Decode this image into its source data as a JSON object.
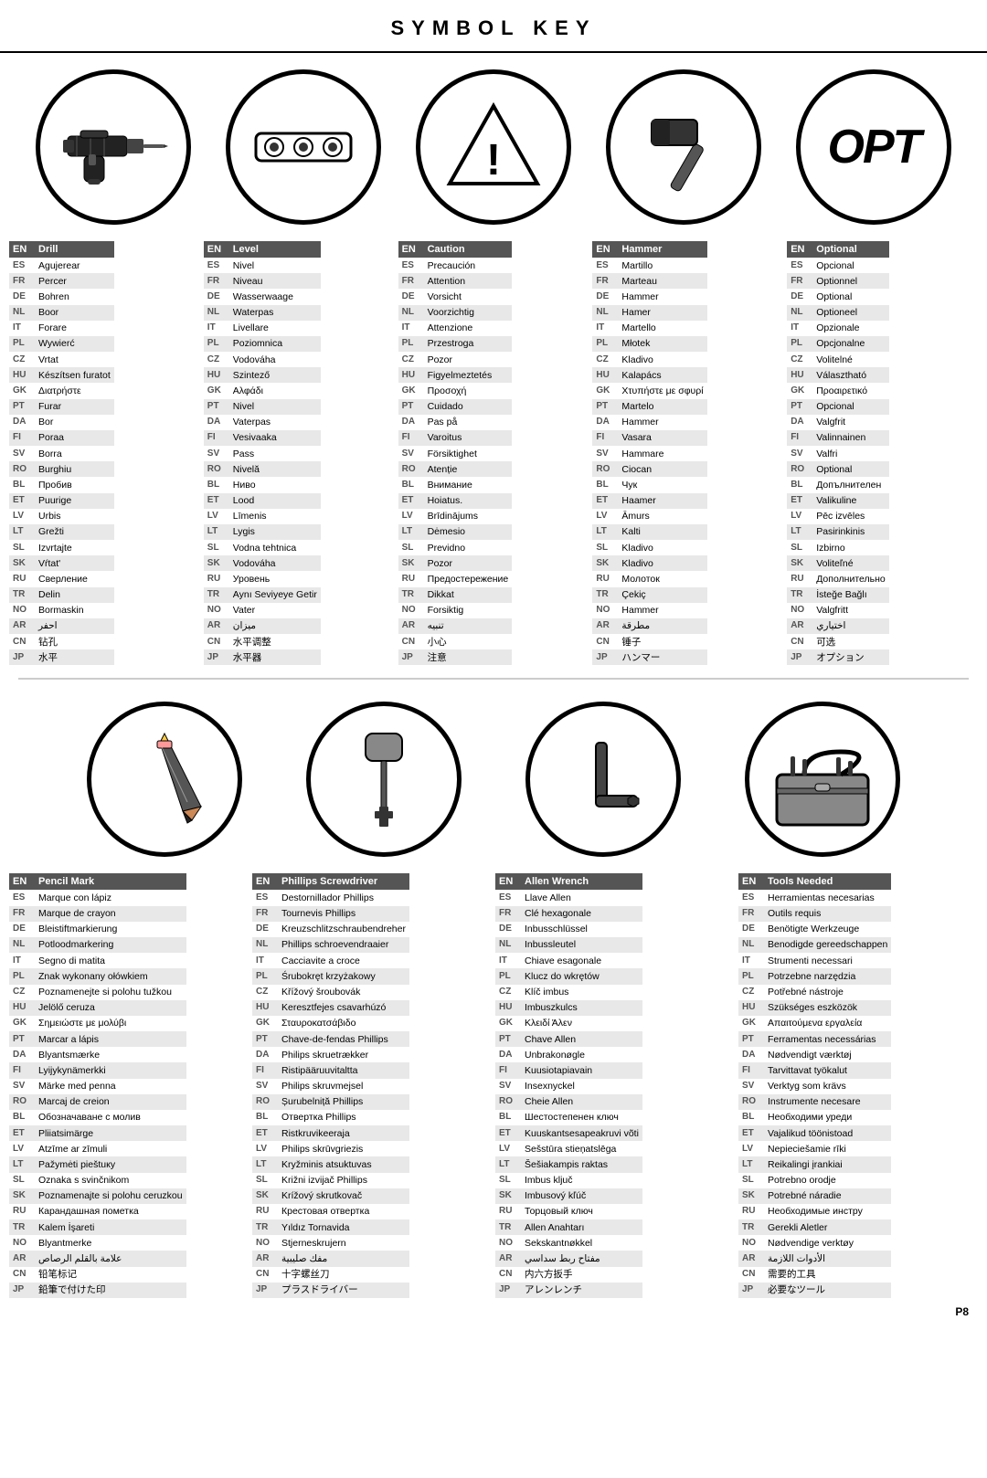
{
  "title": "SYMBOL KEY",
  "page_number": "P8",
  "icons_row1": [
    {
      "name": "drill",
      "type": "drill"
    },
    {
      "name": "level",
      "type": "level"
    },
    {
      "name": "caution",
      "type": "caution"
    },
    {
      "name": "hammer",
      "type": "hammer"
    },
    {
      "name": "optional",
      "type": "opt"
    }
  ],
  "icons_row2": [
    {
      "name": "pencil",
      "type": "pencil"
    },
    {
      "name": "phillips",
      "type": "phillips"
    },
    {
      "name": "allen",
      "type": "allen"
    },
    {
      "name": "toolbox",
      "type": "toolbox"
    }
  ],
  "tables": [
    {
      "id": "drill",
      "header_lang": "EN",
      "header_name": "Drill",
      "rows": [
        [
          "ES",
          "Agujerear"
        ],
        [
          "FR",
          "Percer"
        ],
        [
          "DE",
          "Bohren"
        ],
        [
          "NL",
          "Boor"
        ],
        [
          "IT",
          "Forare"
        ],
        [
          "PL",
          "Wywierć"
        ],
        [
          "CZ",
          "Vrtat"
        ],
        [
          "HU",
          "Készítsen furatot"
        ],
        [
          "GK",
          "Διατρήστε"
        ],
        [
          "PT",
          "Furar"
        ],
        [
          "DA",
          "Bor"
        ],
        [
          "FI",
          "Poraa"
        ],
        [
          "SV",
          "Borra"
        ],
        [
          "RO",
          "Burghiu"
        ],
        [
          "BL",
          "Пробив"
        ],
        [
          "ET",
          "Puurige"
        ],
        [
          "LV",
          "Urbis"
        ],
        [
          "LT",
          "Grežti"
        ],
        [
          "SL",
          "Izvrtajte"
        ],
        [
          "SK",
          "Vŕtat'"
        ],
        [
          "RU",
          "Сверление"
        ],
        [
          "TR",
          "Delin"
        ],
        [
          "NO",
          "Bormaskin"
        ],
        [
          "AR",
          "احفر"
        ],
        [
          "CN",
          "钻孔"
        ],
        [
          "JP",
          "水平"
        ]
      ]
    },
    {
      "id": "level",
      "header_lang": "EN",
      "header_name": "Level",
      "rows": [
        [
          "ES",
          "Nivel"
        ],
        [
          "FR",
          "Niveau"
        ],
        [
          "DE",
          "Wasserwaage"
        ],
        [
          "NL",
          "Waterpas"
        ],
        [
          "IT",
          "Livellare"
        ],
        [
          "PL",
          "Poziomnica"
        ],
        [
          "CZ",
          "Vodováha"
        ],
        [
          "HU",
          "Szintező"
        ],
        [
          "GK",
          "Αλφάδι"
        ],
        [
          "PT",
          "Nivel"
        ],
        [
          "DA",
          "Vaterpas"
        ],
        [
          "FI",
          "Vesivaaka"
        ],
        [
          "SV",
          "Pass"
        ],
        [
          "RO",
          "Nivelă"
        ],
        [
          "BL",
          "Ниво"
        ],
        [
          "ET",
          "Lood"
        ],
        [
          "LV",
          "Līmenis"
        ],
        [
          "LT",
          "Lygis"
        ],
        [
          "SL",
          "Vodna tehtnica"
        ],
        [
          "SK",
          "Vodováha"
        ],
        [
          "RU",
          "Уровень"
        ],
        [
          "TR",
          "Aynı Seviyeye Getir"
        ],
        [
          "NO",
          "Vater"
        ],
        [
          "AR",
          "ميزان"
        ],
        [
          "CN",
          "水平调整"
        ],
        [
          "JP",
          "水平器"
        ]
      ]
    },
    {
      "id": "caution",
      "header_lang": "EN",
      "header_name": "Caution",
      "rows": [
        [
          "ES",
          "Precaución"
        ],
        [
          "FR",
          "Attention"
        ],
        [
          "DE",
          "Vorsicht"
        ],
        [
          "NL",
          "Voorzichtig"
        ],
        [
          "IT",
          "Attenzione"
        ],
        [
          "PL",
          "Przestroga"
        ],
        [
          "CZ",
          "Pozor"
        ],
        [
          "HU",
          "Figyelmeztetés"
        ],
        [
          "GK",
          "Προσοχή"
        ],
        [
          "PT",
          "Cuidado"
        ],
        [
          "DA",
          "Pas på"
        ],
        [
          "FI",
          "Varoitus"
        ],
        [
          "SV",
          "Försiktighet"
        ],
        [
          "RO",
          "Atenție"
        ],
        [
          "BL",
          "Внимание"
        ],
        [
          "ET",
          "Hoiatus."
        ],
        [
          "LV",
          "Brīdinājums"
        ],
        [
          "LT",
          "Dėmesio"
        ],
        [
          "SL",
          "Previdno"
        ],
        [
          "SK",
          "Pozor"
        ],
        [
          "RU",
          "Предостережение"
        ],
        [
          "TR",
          "Dikkat"
        ],
        [
          "NO",
          "Forsiktig"
        ],
        [
          "AR",
          "تنبيه"
        ],
        [
          "CN",
          "小心"
        ],
        [
          "JP",
          "注意"
        ]
      ]
    },
    {
      "id": "hammer",
      "header_lang": "EN",
      "header_name": "Hammer",
      "rows": [
        [
          "ES",
          "Martillo"
        ],
        [
          "FR",
          "Marteau"
        ],
        [
          "DE",
          "Hammer"
        ],
        [
          "NL",
          "Hamer"
        ],
        [
          "IT",
          "Martello"
        ],
        [
          "PL",
          "Młotek"
        ],
        [
          "CZ",
          "Kladivo"
        ],
        [
          "HU",
          "Kalapács"
        ],
        [
          "GK",
          "Χτυπήστε με σφυρί"
        ],
        [
          "PT",
          "Martelo"
        ],
        [
          "DA",
          "Hammer"
        ],
        [
          "FI",
          "Vasara"
        ],
        [
          "SV",
          "Hammare"
        ],
        [
          "RO",
          "Ciocan"
        ],
        [
          "BL",
          "Чук"
        ],
        [
          "ET",
          "Haamer"
        ],
        [
          "LV",
          "Āmurs"
        ],
        [
          "LT",
          "Kalti"
        ],
        [
          "SL",
          "Kladivo"
        ],
        [
          "SK",
          "Kladivo"
        ],
        [
          "RU",
          "Молоток"
        ],
        [
          "TR",
          "Çekiç"
        ],
        [
          "NO",
          "Hammer"
        ],
        [
          "AR",
          "مطرقة"
        ],
        [
          "CN",
          "锤子"
        ],
        [
          "JP",
          "ハンマー"
        ]
      ]
    },
    {
      "id": "optional",
      "header_lang": "EN",
      "header_name": "Optional",
      "rows": [
        [
          "ES",
          "Opcional"
        ],
        [
          "FR",
          "Optionnel"
        ],
        [
          "DE",
          "Optional"
        ],
        [
          "NL",
          "Optioneel"
        ],
        [
          "IT",
          "Opzionale"
        ],
        [
          "PL",
          "Opcjonalne"
        ],
        [
          "CZ",
          "Volitelné"
        ],
        [
          "HU",
          "Választható"
        ],
        [
          "GK",
          "Προαιρετικό"
        ],
        [
          "PT",
          "Opcional"
        ],
        [
          "DA",
          "Valgfrit"
        ],
        [
          "FI",
          "Valinnainen"
        ],
        [
          "SV",
          "Valfri"
        ],
        [
          "RO",
          "Optional"
        ],
        [
          "BL",
          "Допълнителен"
        ],
        [
          "ET",
          "Valikuline"
        ],
        [
          "LV",
          "Pēc izvēles"
        ],
        [
          "LT",
          "Pasirinkinis"
        ],
        [
          "SL",
          "Izbirno"
        ],
        [
          "SK",
          "Voliteľné"
        ],
        [
          "RU",
          "Дополнительно"
        ],
        [
          "TR",
          "İsteğe Bağlı"
        ],
        [
          "NO",
          "Valgfritt"
        ],
        [
          "AR",
          "اختياري"
        ],
        [
          "CN",
          "可选"
        ],
        [
          "JP",
          "オプション"
        ]
      ]
    }
  ],
  "tables2": [
    {
      "id": "pencil",
      "header_lang": "EN",
      "header_name": "Pencil Mark",
      "rows": [
        [
          "ES",
          "Marque con lápiz"
        ],
        [
          "FR",
          "Marque de crayon"
        ],
        [
          "DE",
          "Bleistiftmarkierung"
        ],
        [
          "NL",
          "Potloodmarkering"
        ],
        [
          "IT",
          "Segno di matita"
        ],
        [
          "PL",
          "Znak wykonany ołówkiem"
        ],
        [
          "CZ",
          "Poznamenejte si polohu tužkou"
        ],
        [
          "HU",
          "Jelölő ceruza"
        ],
        [
          "GK",
          "Σημειώστε με μολύβι"
        ],
        [
          "PT",
          "Marcar a lápis"
        ],
        [
          "DA",
          "Blyantsmærke"
        ],
        [
          "FI",
          "Lyijykynämerkki"
        ],
        [
          "SV",
          "Märke med penna"
        ],
        [
          "RO",
          "Marcaj de creion"
        ],
        [
          "BL",
          "Обозначаване с молив"
        ],
        [
          "ET",
          "Pliiatsimärge"
        ],
        [
          "LV",
          "Atzīme ar zīmuli"
        ],
        [
          "LT",
          "Pažymėti pieštuку"
        ],
        [
          "SL",
          "Oznaka s svinčnikom"
        ],
        [
          "SK",
          "Poznamenajte si polohu ceruzkou"
        ],
        [
          "RU",
          "Карандашная пометка"
        ],
        [
          "TR",
          "Kalem İşareti"
        ],
        [
          "NO",
          "Blyantmerke"
        ],
        [
          "AR",
          "علامة بالقلم الرصاص"
        ],
        [
          "CN",
          "铅笔标记"
        ],
        [
          "JP",
          "鉛筆で付けた印"
        ]
      ]
    },
    {
      "id": "phillips",
      "header_lang": "EN",
      "header_name": "Phillips Screwdriver",
      "rows": [
        [
          "ES",
          "Destornillador Phillips"
        ],
        [
          "FR",
          "Tournevis Phillips"
        ],
        [
          "DE",
          "Kreuzschlitzschraubendreher"
        ],
        [
          "NL",
          "Phillips schroevendraaier"
        ],
        [
          "IT",
          "Cacciavite a croce"
        ],
        [
          "PL",
          "Śrubokręt krzyżakowy"
        ],
        [
          "CZ",
          "Křížový šroubovák"
        ],
        [
          "HU",
          "Keresztfejes csavarhúzó"
        ],
        [
          "GK",
          "Σταυροκατσάβιδο"
        ],
        [
          "PT",
          "Chave-de-fendas Phillips"
        ],
        [
          "DA",
          "Philips skruetrækker"
        ],
        [
          "FI",
          "Ristipääruuvitaltta"
        ],
        [
          "SV",
          "Philips skruvmejsel"
        ],
        [
          "RO",
          "Șurubelniță Phillips"
        ],
        [
          "BL",
          "Отвертка Phillips"
        ],
        [
          "ET",
          "Ristkruvikeeraja"
        ],
        [
          "LV",
          "Philips skrūvgriezis"
        ],
        [
          "LT",
          "Kryžminis atsuktuvas"
        ],
        [
          "SL",
          "Križni izvijač Phillips"
        ],
        [
          "SK",
          "Krížový skrutkovač"
        ],
        [
          "RU",
          "Крестовая отвертка"
        ],
        [
          "TR",
          "Yıldız Tornavida"
        ],
        [
          "NO",
          "Stjerneskrujern"
        ],
        [
          "AR",
          "مفك صليبية"
        ],
        [
          "CN",
          "十字螺丝刀"
        ],
        [
          "JP",
          "プラスドライバー"
        ]
      ]
    },
    {
      "id": "allen",
      "header_lang": "EN",
      "header_name": "Allen Wrench",
      "rows": [
        [
          "ES",
          "Llave Allen"
        ],
        [
          "FR",
          "Clé hexagonale"
        ],
        [
          "DE",
          "Inbusschlüssel"
        ],
        [
          "NL",
          "Inbussleutel"
        ],
        [
          "IT",
          "Chiave esagonale"
        ],
        [
          "PL",
          "Klucz do wkrętów"
        ],
        [
          "CZ",
          "Klíč imbus"
        ],
        [
          "HU",
          "Imbuszkulcs"
        ],
        [
          "GK",
          "Κλειδί Άλεν"
        ],
        [
          "PT",
          "Chave Allen"
        ],
        [
          "DA",
          "Unbrakonøgle"
        ],
        [
          "FI",
          "Kuusiotapiavain"
        ],
        [
          "SV",
          "Insexnyckel"
        ],
        [
          "RO",
          "Cheie Allen"
        ],
        [
          "BL",
          "Шестостепенен ключ"
        ],
        [
          "ET",
          "Kuuskantsesapeakruvi võti"
        ],
        [
          "LV",
          "Sešstūra stieņatslēga"
        ],
        [
          "LT",
          "Šešiakampis raktas"
        ],
        [
          "SL",
          "Imbus ključ"
        ],
        [
          "SK",
          "Imbusový kľúč"
        ],
        [
          "RU",
          "Торцовый ключ"
        ],
        [
          "TR",
          "Allen Anahtarı"
        ],
        [
          "NO",
          "Sekskantnøkkel"
        ],
        [
          "AR",
          "مفتاح ربط سداسي"
        ],
        [
          "CN",
          "内六方扳手"
        ],
        [
          "JP",
          "アレンレンチ"
        ]
      ]
    },
    {
      "id": "tools",
      "header_lang": "EN",
      "header_name": "Tools Needed",
      "rows": [
        [
          "ES",
          "Herramientas necesarias"
        ],
        [
          "FR",
          "Outils requis"
        ],
        [
          "DE",
          "Benötigte Werkzeuge"
        ],
        [
          "NL",
          "Benodigde gereedschappen"
        ],
        [
          "IT",
          "Strumenti necessari"
        ],
        [
          "PL",
          "Potrzebne narzędzia"
        ],
        [
          "CZ",
          "Potřebné nástroje"
        ],
        [
          "HU",
          "Szükséges eszközök"
        ],
        [
          "GK",
          "Απαιτούμενα εργαλεία"
        ],
        [
          "PT",
          "Ferramentas necessárias"
        ],
        [
          "DA",
          "Nødvendigt værktøj"
        ],
        [
          "FI",
          "Tarvittavat työkalut"
        ],
        [
          "SV",
          "Verktyg som krävs"
        ],
        [
          "RO",
          "Instrumente necesare"
        ],
        [
          "BL",
          "Необходими уреди"
        ],
        [
          "ET",
          "Vajalikud töönistoad"
        ],
        [
          "LV",
          "Nepieciešamie rīki"
        ],
        [
          "LT",
          "Reikalingi įrankiai"
        ],
        [
          "SL",
          "Potrebno orodje"
        ],
        [
          "SK",
          "Potrebné náradie"
        ],
        [
          "RU",
          "Необходимые инстру"
        ],
        [
          "TR",
          "Gerekli Aletler"
        ],
        [
          "NO",
          "Nødvendige verktøy"
        ],
        [
          "AR",
          "الأدوات اللازمة"
        ],
        [
          "CN",
          "需要的工具"
        ],
        [
          "JP",
          "必要なツール"
        ]
      ]
    }
  ]
}
